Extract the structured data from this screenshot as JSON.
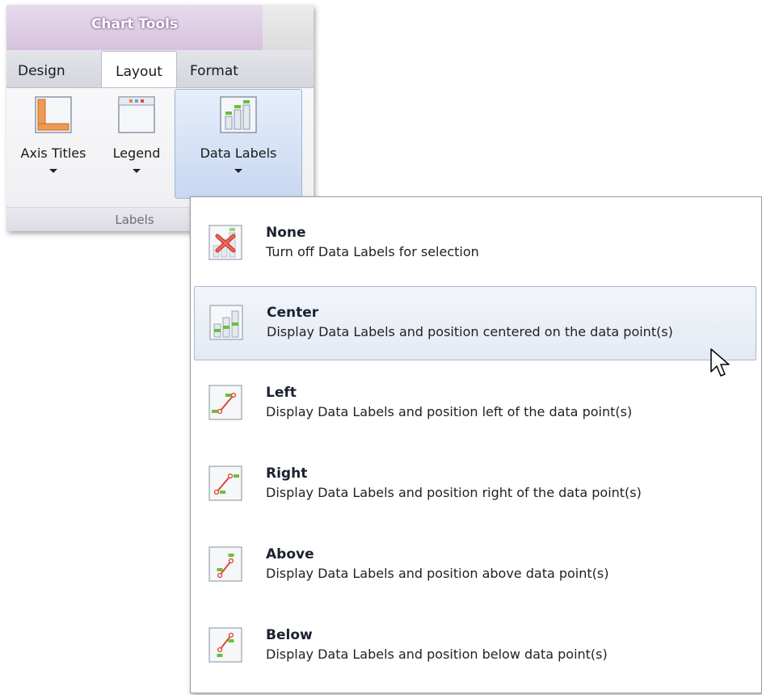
{
  "ribbon": {
    "context_title": "Chart Tools",
    "tabs": [
      {
        "label": "Design",
        "active": false
      },
      {
        "label": "Layout",
        "active": true
      },
      {
        "label": "Format",
        "active": false
      }
    ],
    "buttons": [
      {
        "label": "Axis Titles",
        "icon": "axis-titles-icon"
      },
      {
        "label": "Legend",
        "icon": "legend-icon"
      },
      {
        "label": "Data Labels",
        "icon": "data-labels-icon",
        "highlighted": true
      }
    ],
    "group_label": "Labels"
  },
  "menu": {
    "items": [
      {
        "title": "None",
        "description": "Turn off Data Labels for selection",
        "icon": "none-labels-icon"
      },
      {
        "title": "Center",
        "description": "Display Data Labels and position centered on the data point(s)",
        "icon": "center-labels-icon",
        "hovered": true
      },
      {
        "title": "Left",
        "description": "Display Data Labels and position left of the data point(s)",
        "icon": "left-labels-icon"
      },
      {
        "title": "Right",
        "description": "Display Data Labels and position right of the data point(s)",
        "icon": "right-labels-icon"
      },
      {
        "title": "Above",
        "description": "Display Data Labels and position above data point(s)",
        "icon": "above-labels-icon"
      },
      {
        "title": "Below",
        "description": "Display Data Labels and position below data point(s)",
        "icon": "below-labels-icon"
      }
    ]
  },
  "colors": {
    "context_accent": "#d6c2df",
    "hover_border": "#a9b7cf",
    "icon_green": "#6abf3a",
    "icon_red": "#d94a3a",
    "icon_orange": "#e8883a"
  }
}
